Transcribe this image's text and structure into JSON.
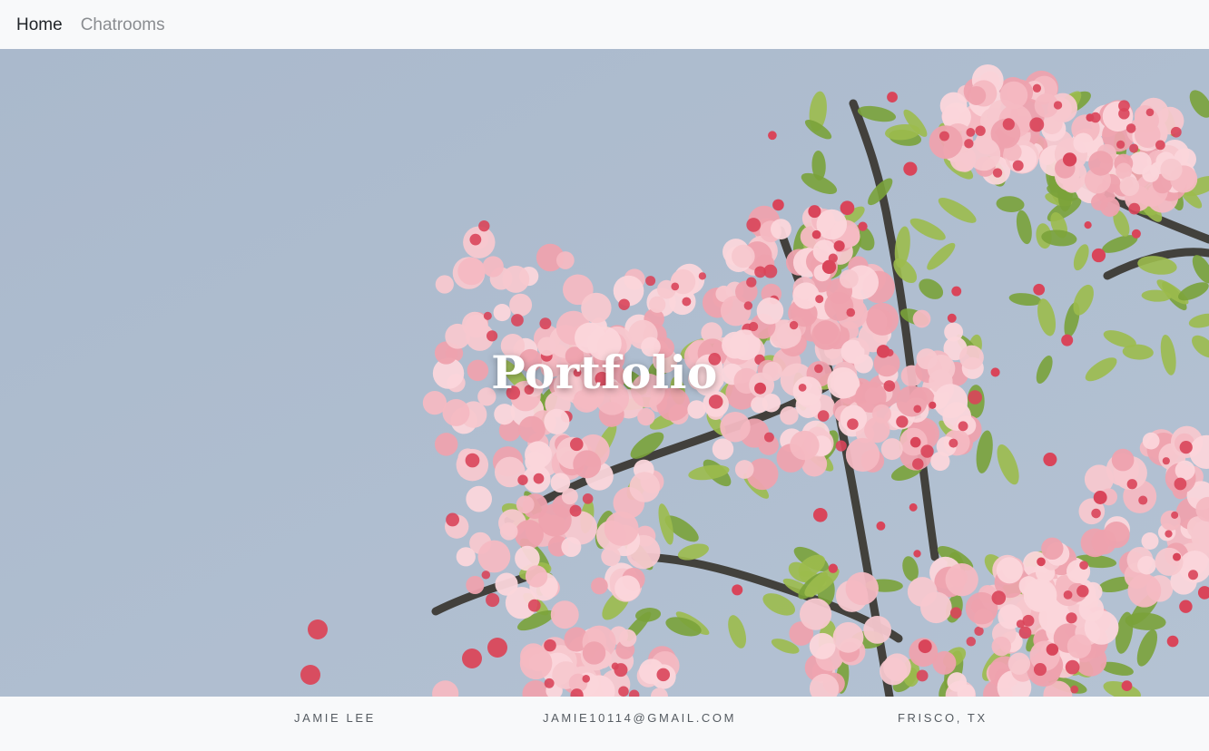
{
  "nav": {
    "links": [
      {
        "label": "Home",
        "active": true
      },
      {
        "label": "Chatrooms",
        "active": false
      }
    ]
  },
  "hero": {
    "title": "Portfolio",
    "image": "pink cherry blossom branches against pale blue sky"
  },
  "footer": {
    "name": "JAMIE LEE",
    "email": "JAMIE10114@GMAIL.COM",
    "location": "FRISCO, TX"
  },
  "colors": {
    "nav_bg": "#f8f9fa",
    "sky": "#a8b8cc",
    "blossom": "#f2aeb8",
    "blossom_dark": "#d9455a",
    "leaf": "#7aa23a",
    "branch": "#2f2a22",
    "footer_text": "#555b61"
  }
}
